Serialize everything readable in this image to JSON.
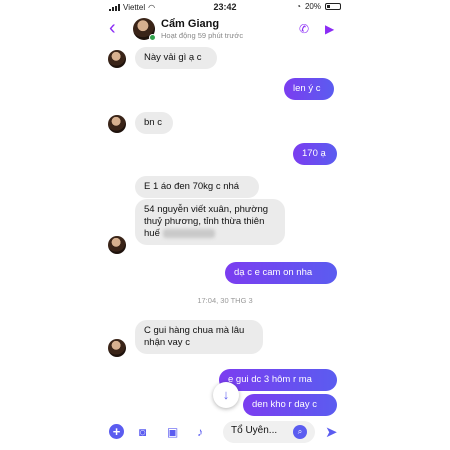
{
  "status": {
    "carrier": "Viettel",
    "time": "23:42",
    "battery": "20%"
  },
  "header": {
    "back_icon": "chevron-left-icon",
    "name": "Cẩm Giang",
    "activity": "Hoạt động 59 phút trước",
    "accent": "#8b2cf5"
  },
  "messages": [
    {
      "side": "in",
      "text": "Này vải gì ạ c"
    },
    {
      "side": "out",
      "text": "len ý c"
    },
    {
      "side": "in",
      "text": "bn c"
    },
    {
      "side": "out",
      "text": "170 ạ"
    },
    {
      "side": "in",
      "text": "E 1 áo đen 70kg c nhá"
    },
    {
      "side": "in",
      "text": "54 nguyễn viết xuân, phường thuỷ phương, tỉnh thừa thiên huế"
    },
    {
      "side": "out",
      "text": "dạ c e cam on nha"
    },
    {
      "side": "in",
      "text": "C gui hàng chua mà lâu nhận vay c"
    },
    {
      "side": "out",
      "text": "e gui dc 3 hôm r ma"
    },
    {
      "side": "out",
      "text": "den kho r day c"
    }
  ],
  "timestamp": "17:04, 30 THG 3",
  "composer": {
    "input_value": "Tổ Uyên...",
    "accent": "#5b5cf0"
  }
}
